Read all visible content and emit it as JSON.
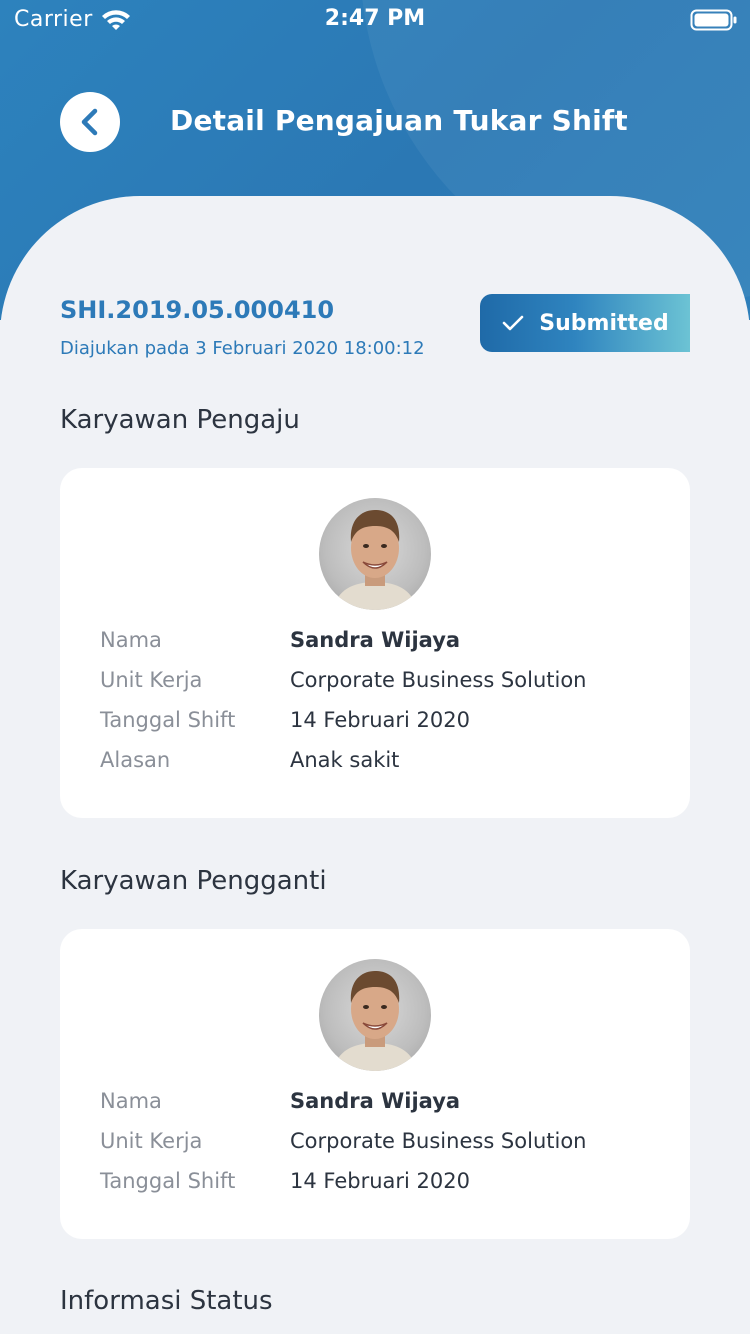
{
  "status_bar": {
    "carrier": "Carrier",
    "time": "2:47 PM"
  },
  "header": {
    "title": "Detail Pengajuan Tukar Shift",
    "back_icon": "chevron-left-icon"
  },
  "request": {
    "id": "SHI.2019.05.000410",
    "submitted_at": "Diajukan pada 3 Februari 2020 18:00:12",
    "status_label": "Submitted",
    "status_icon": "check-icon"
  },
  "requester": {
    "section_title": "Karyawan Pengaju",
    "rows": [
      {
        "label": "Nama",
        "value": "Sandra Wijaya"
      },
      {
        "label": "Unit Kerja",
        "value": "Corporate Business Solution"
      },
      {
        "label": "Tanggal Shift",
        "value": "14 Februari 2020"
      },
      {
        "label": "Alasan",
        "value": "Anak sakit"
      }
    ]
  },
  "replacement": {
    "section_title": "Karyawan Pengganti",
    "rows": [
      {
        "label": "Nama",
        "value": "Sandra Wijaya"
      },
      {
        "label": "Unit Kerja",
        "value": "Corporate Business Solution"
      },
      {
        "label": "Tanggal Shift",
        "value": "14 Februari 2020"
      }
    ]
  },
  "status_info": {
    "section_title": "Informasi Status"
  },
  "colors": {
    "header_blue": "#2b78b4",
    "accent_text": "#2d7ab8",
    "background": "#f0f2f6"
  }
}
